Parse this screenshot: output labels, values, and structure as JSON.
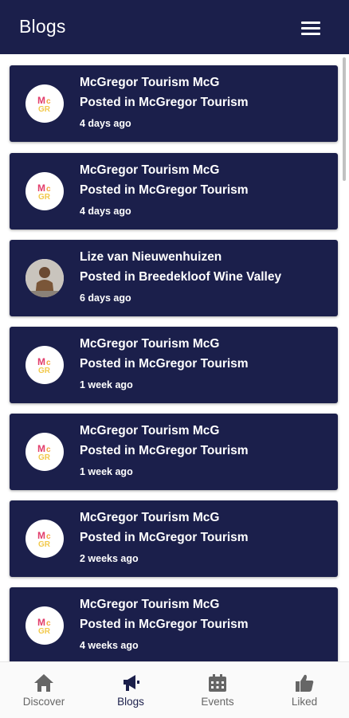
{
  "header": {
    "title": "Blogs",
    "menu_icon": "hamburger-menu-icon"
  },
  "colors": {
    "primary": "#1b1f4b",
    "nav_inactive": "#666666",
    "background": "#ffffff"
  },
  "posts": [
    {
      "author": "McGregor Tourism McG",
      "posted_in": "Posted in McGregor Tourism",
      "time": "4 days ago",
      "avatar": "mcgregor-logo"
    },
    {
      "author": "McGregor Tourism McG",
      "posted_in": "Posted in McGregor Tourism",
      "time": "4 days ago",
      "avatar": "mcgregor-logo"
    },
    {
      "author": "Lize van Nieuwenhuizen",
      "posted_in": "Posted in Breedekloof Wine Valley",
      "time": "6 days ago",
      "avatar": "person-photo"
    },
    {
      "author": "McGregor Tourism McG",
      "posted_in": "Posted in McGregor Tourism",
      "time": "1 week ago",
      "avatar": "mcgregor-logo"
    },
    {
      "author": "McGregor Tourism McG",
      "posted_in": "Posted in McGregor Tourism",
      "time": "1 week ago",
      "avatar": "mcgregor-logo"
    },
    {
      "author": "McGregor Tourism McG",
      "posted_in": "Posted in McGregor Tourism",
      "time": "2 weeks ago",
      "avatar": "mcgregor-logo"
    },
    {
      "author": "McGregor Tourism McG",
      "posted_in": "Posted in McGregor Tourism",
      "time": "4 weeks ago",
      "avatar": "mcgregor-logo"
    }
  ],
  "bottom_nav": {
    "active": "Blogs",
    "items": [
      {
        "label": "Discover",
        "icon": "home-icon"
      },
      {
        "label": "Blogs",
        "icon": "megaphone-icon"
      },
      {
        "label": "Events",
        "icon": "calendar-icon"
      },
      {
        "label": "Liked",
        "icon": "thumbs-up-icon"
      }
    ]
  }
}
